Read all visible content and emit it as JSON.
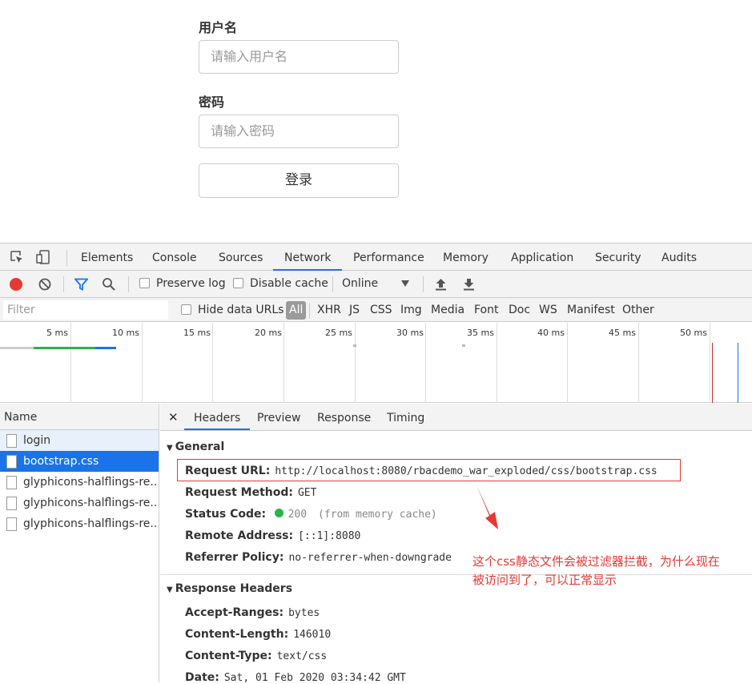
{
  "login": {
    "username_label": "用户名",
    "username_placeholder": "请输入用户名",
    "password_label": "密码",
    "password_placeholder": "请输入密码",
    "submit_label": "登录"
  },
  "devtools": {
    "tabs": [
      "Elements",
      "Console",
      "Sources",
      "Network",
      "Performance",
      "Memory",
      "Application",
      "Security",
      "Audits"
    ],
    "active_tab": "Network",
    "toolbar": {
      "preserve_log": "Preserve log",
      "disable_cache": "Disable cache",
      "throttle": "Online"
    },
    "filter": {
      "placeholder": "Filter",
      "hide_data_urls": "Hide data URLs",
      "types": [
        "All",
        "XHR",
        "JS",
        "CSS",
        "Img",
        "Media",
        "Font",
        "Doc",
        "WS",
        "Manifest",
        "Other"
      ]
    },
    "timeline_ticks": [
      "5 ms",
      "10 ms",
      "15 ms",
      "20 ms",
      "25 ms",
      "30 ms",
      "35 ms",
      "40 ms",
      "45 ms",
      "50 ms"
    ],
    "name_header": "Name",
    "requests": [
      "login",
      "bootstrap.css",
      "glyphicons-halflings-re...",
      "glyphicons-halflings-re...",
      "glyphicons-halflings-re..."
    ],
    "detail_tabs": [
      "Headers",
      "Preview",
      "Response",
      "Timing"
    ],
    "general": {
      "title": "General",
      "request_url_key": "Request URL:",
      "request_url": "http://localhost:8080/rbacdemo_war_exploded/css/bootstrap.css",
      "request_method_key": "Request Method:",
      "request_method": "GET",
      "status_code_key": "Status Code:",
      "status_code": "200",
      "status_note": "(from memory cache)",
      "remote_address_key": "Remote Address:",
      "remote_address": "[::1]:8080",
      "referrer_policy_key": "Referrer Policy:",
      "referrer_policy": "no-referrer-when-downgrade"
    },
    "response_headers": {
      "title": "Response Headers",
      "accept_ranges_key": "Accept-Ranges:",
      "accept_ranges": "bytes",
      "content_length_key": "Content-Length:",
      "content_length": "146010",
      "content_type_key": "Content-Type:",
      "content_type": "text/css",
      "date_key": "Date:",
      "date": "Sat, 01 Feb 2020 03:34:42 GMT"
    }
  },
  "annotation": {
    "line1": "这个css静态文件会被过滤器拦截，为什么现在",
    "line2": "被访问到了，可以正常显示"
  },
  "colors": {
    "accent": "#1a73e8",
    "record": "#e53935",
    "status_ok": "#2bb24c",
    "annotation": "#e53935"
  }
}
